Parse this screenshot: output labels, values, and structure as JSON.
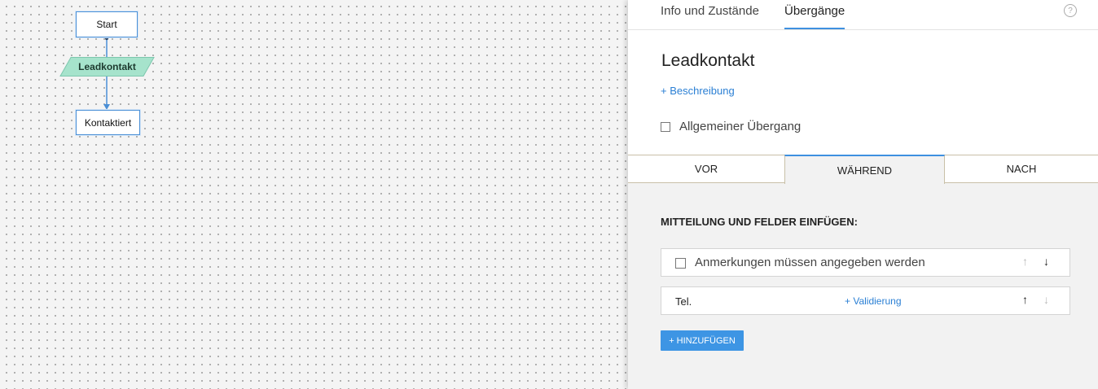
{
  "canvas": {
    "nodes": {
      "start": "Start",
      "lead": "Leadkontakt",
      "contacted": "Kontaktiert"
    },
    "colors": {
      "lead_fill": "#a6e3cc",
      "node_border": "#4a8fd6"
    }
  },
  "panel": {
    "tabs": [
      "Info und Zustände",
      "Übergänge"
    ],
    "active_tab": "Übergänge",
    "help_icon": "?",
    "title": "Leadkontakt",
    "description_link": "+ Beschreibung",
    "general_transition_label": "Allgemeiner Übergang",
    "subtabs": [
      "VOR",
      "WÄHREND",
      "NACH"
    ],
    "active_subtab": "WÄHREND",
    "section_label": "MITTEILUNG UND FELDER EINFÜGEN:",
    "fields": [
      {
        "label": "Anmerkungen müssen angegeben werden",
        "up": "↑",
        "down": "↓"
      },
      {
        "label": "Tel.",
        "link": "+ Validierung",
        "up": "↑",
        "down": "↓"
      }
    ],
    "add_button": "+ HINZUFÜGEN",
    "accent": "#3e90e0"
  }
}
